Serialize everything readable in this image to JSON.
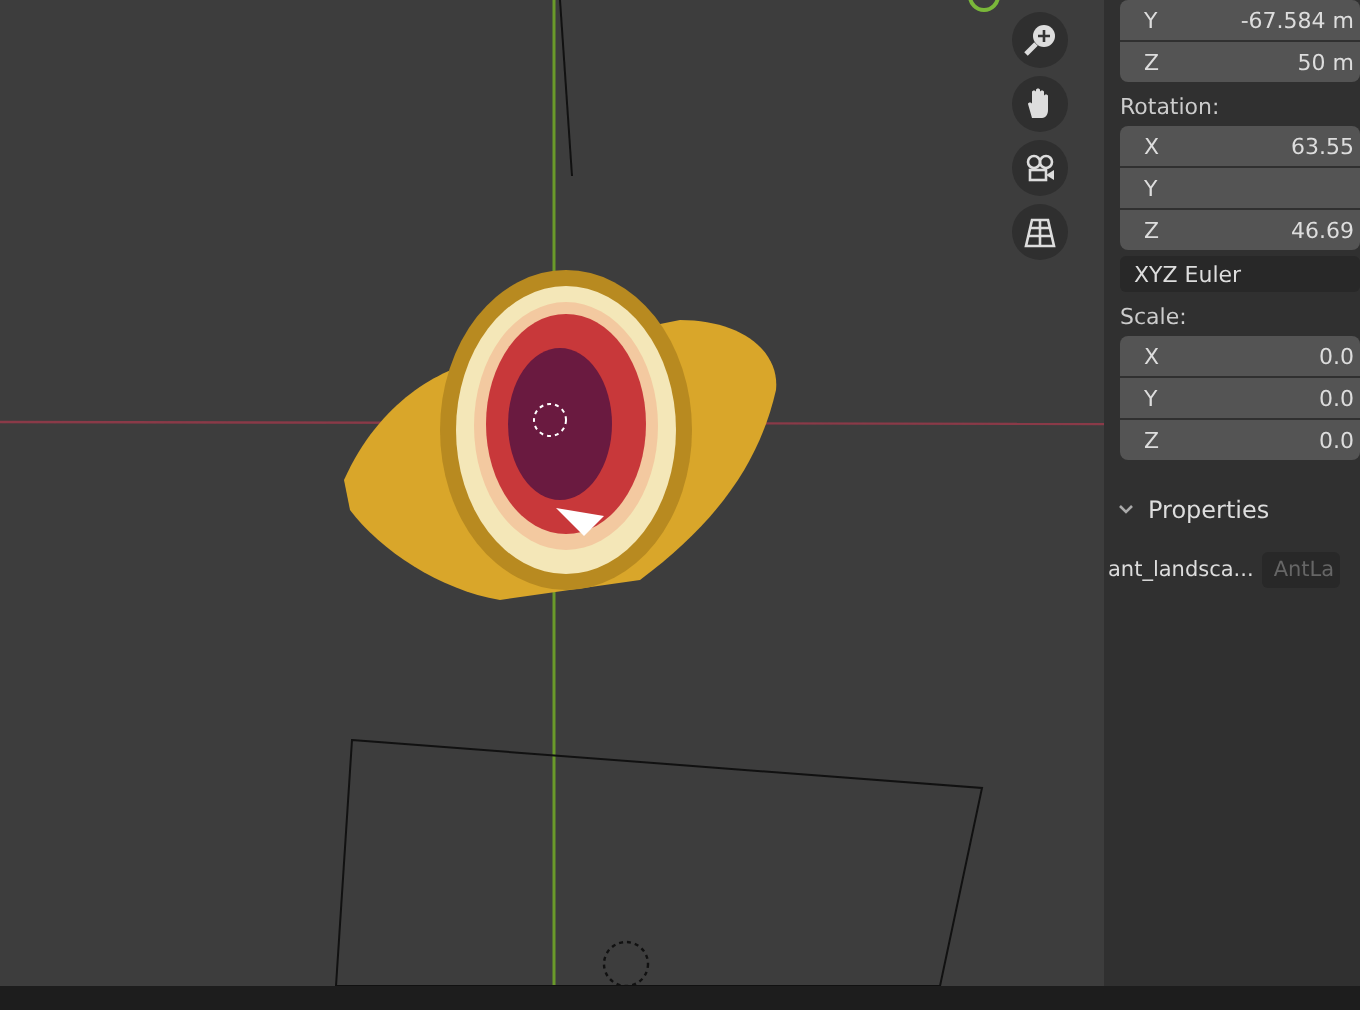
{
  "location": {
    "rows": [
      {
        "axis": "Y",
        "value": "-67.584 m"
      },
      {
        "axis": "Z",
        "value": "50 m"
      }
    ]
  },
  "rotation": {
    "label": "Rotation:",
    "rows": [
      {
        "axis": "X",
        "value": "63.55"
      },
      {
        "axis": "Y"
      },
      {
        "axis": "Z",
        "value": "46.69"
      }
    ],
    "mode": "XYZ Euler"
  },
  "scale": {
    "label": "Scale:",
    "rows": [
      {
        "axis": "X",
        "value": "0.0"
      },
      {
        "axis": "Y",
        "value": "0.0"
      },
      {
        "axis": "Z",
        "value": "0.0"
      }
    ]
  },
  "properties": {
    "title": "Properties",
    "expanded": true,
    "items": [
      {
        "label": "ant_landsca...",
        "value": "AntLa"
      }
    ]
  }
}
